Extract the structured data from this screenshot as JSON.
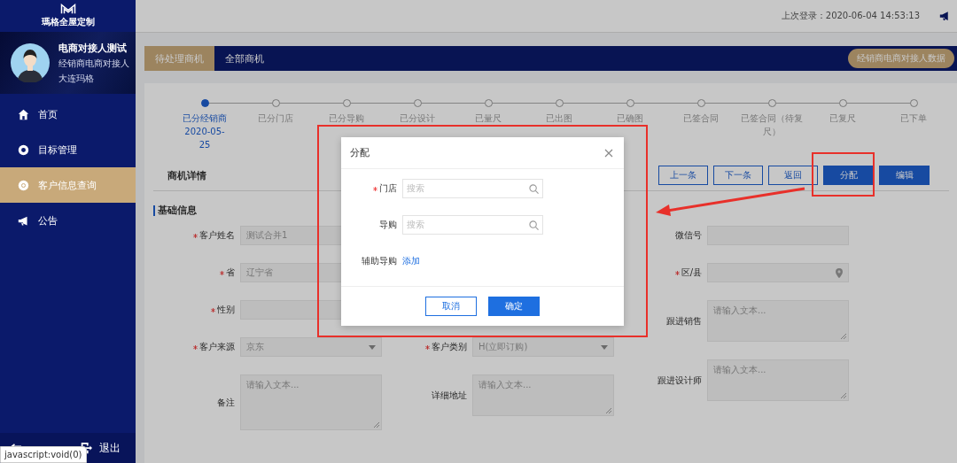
{
  "sidebar": {
    "logo_text": "瑪格全屋定制",
    "user": {
      "name": "电商对接人测试",
      "role": "经销商电商对接人",
      "company": "大连玛格"
    },
    "nav": [
      {
        "label": "首页",
        "selected": false
      },
      {
        "label": "目标管理",
        "selected": false
      },
      {
        "label": "客户信息查询",
        "selected": true
      },
      {
        "label": "公告",
        "selected": false
      }
    ],
    "logout": "退出"
  },
  "header": {
    "last_login": "上次登录：2020-06-04 14:53:13"
  },
  "tabs": [
    {
      "label": "待处理商机",
      "selected": true
    },
    {
      "label": "全部商机",
      "selected": false
    }
  ],
  "data_button": "经销商电商对接人数据",
  "steps": [
    {
      "label": "已分经销商",
      "date": "2020-05-25",
      "current": true
    },
    {
      "label": "已分门店",
      "current": false
    },
    {
      "label": "已分导购",
      "current": false
    },
    {
      "label": "已分设计",
      "current": false
    },
    {
      "label": "已量尺",
      "current": false
    },
    {
      "label": "已出图",
      "current": false
    },
    {
      "label": "已确图",
      "current": false
    },
    {
      "label": "已签合同",
      "current": false
    },
    {
      "label": "已签合同（待复尺）",
      "current": false
    },
    {
      "label": "已复尺",
      "current": false
    },
    {
      "label": "已下单",
      "current": false
    }
  ],
  "detail": {
    "title": "商机详情",
    "buttons": [
      {
        "label": "上一条",
        "kind": "outline"
      },
      {
        "label": "下一条",
        "kind": "outline"
      },
      {
        "label": "返回",
        "kind": "outline"
      },
      {
        "label": "分配",
        "kind": "primary"
      },
      {
        "label": "编辑",
        "kind": "primary"
      }
    ],
    "section": "基础信息",
    "columns": [
      [
        {
          "label": "客户姓名",
          "required": true,
          "kind": "input",
          "value": "测试合并1"
        },
        {
          "label": "省",
          "required": true,
          "kind": "input",
          "value": "辽宁省"
        },
        {
          "label": "性别",
          "required": true,
          "kind": "input"
        },
        {
          "label": "客户来源",
          "required": true,
          "kind": "select",
          "value": "京东"
        },
        {
          "label": "备注",
          "required": false,
          "kind": "tall_textarea",
          "placeholder": "请输入文本..."
        }
      ],
      [
        {
          "label": "客户类别",
          "required": true,
          "kind": "select",
          "value": "H(立即订购)"
        },
        {
          "label": "详细地址",
          "required": false,
          "kind": "textarea",
          "placeholder": "请输入文本..."
        }
      ],
      [
        {
          "label": "微信号",
          "required": false,
          "kind": "input"
        },
        {
          "label": "区/县",
          "required": true,
          "kind": "location"
        },
        {
          "label": "跟进销售",
          "required": false,
          "kind": "textarea",
          "placeholder": "请输入文本..."
        },
        {
          "label": "跟进设计师",
          "required": false,
          "kind": "textarea",
          "placeholder": "请输入文本..."
        }
      ]
    ]
  },
  "modal": {
    "title": "分配",
    "fields": [
      {
        "label": "门店",
        "required": true,
        "kind": "search",
        "placeholder": "搜索"
      },
      {
        "label": "导购",
        "required": false,
        "kind": "search",
        "placeholder": "搜索"
      },
      {
        "label": "辅助导购",
        "required": false,
        "kind": "link",
        "link": "添加"
      }
    ],
    "cancel": "取消",
    "confirm": "确定"
  },
  "status_tooltip": "javascript:void(0)"
}
